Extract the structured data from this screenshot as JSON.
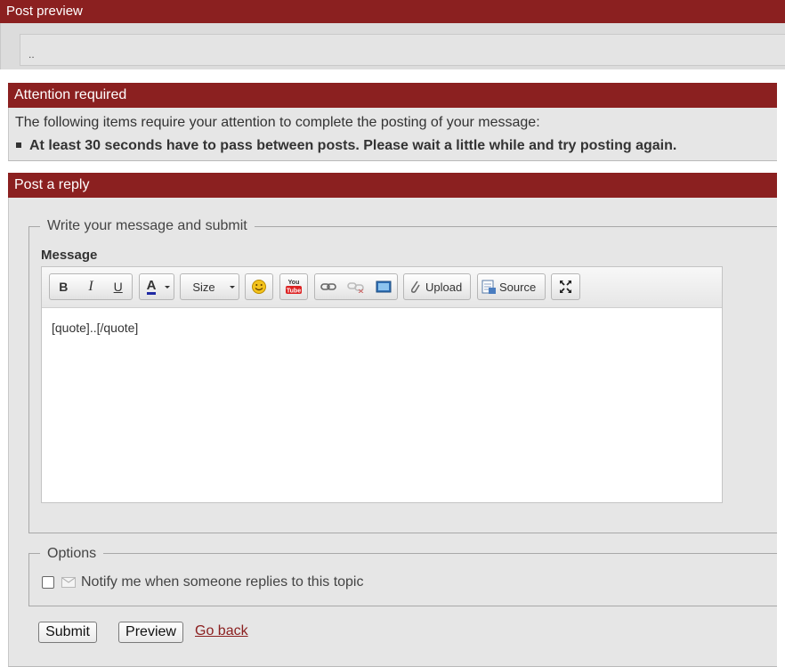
{
  "post_preview": {
    "title": "Post preview",
    "content": ".."
  },
  "attention": {
    "title": "Attention required",
    "message": "The following items require your attention to complete the posting of your message:",
    "items": [
      "At least 30 seconds have to pass between posts. Please wait a little while and try posting again."
    ]
  },
  "reply": {
    "title": "Post a reply",
    "fieldset_legend": "Write your message and submit",
    "message_label": "Message",
    "toolbar": {
      "bold": "B",
      "italic": "I",
      "underline": "U",
      "text_color": "A",
      "size": "Size",
      "emoticon_icon": "smiley-icon",
      "youtube_icon": "youtube-icon",
      "link_icon": "link-icon",
      "unlink_icon": "unlink-icon",
      "image_icon": "image-icon",
      "upload": "Upload",
      "source": "Source",
      "maximize_icon": "maximize-icon"
    },
    "editor_content": "[quote]..[/quote]",
    "options_legend": "Options",
    "notify_label": "Notify me when someone replies to this topic",
    "notify_checked": false,
    "submit": "Submit",
    "preview": "Preview",
    "go_back": "Go back"
  },
  "colors": {
    "header_bg": "#8b2020",
    "panel_bg": "#e6e6e6",
    "link": "#8b2020"
  }
}
